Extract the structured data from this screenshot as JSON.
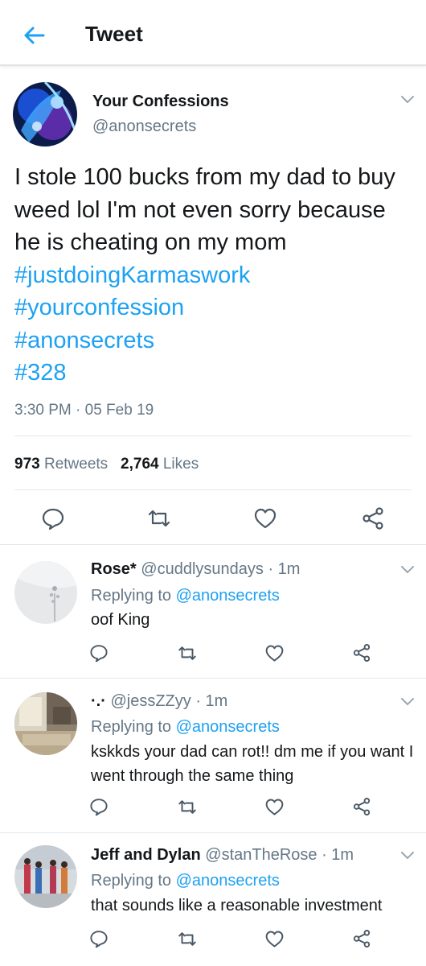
{
  "header": {
    "title": "Tweet"
  },
  "tweet": {
    "author_name": "Your Confessions",
    "author_handle": "@anonsecrets",
    "text": "I stole 100 bucks from my dad to buy weed lol I'm not even sorry because he is cheating on my mom",
    "hashtags": [
      "#justdoingKarmaswork",
      "#yourconfession",
      "#anonsecrets",
      "#328"
    ],
    "timestamp": "3:30 PM · 05 Feb 19",
    "retweet_count": "973",
    "retweet_label": "Retweets",
    "like_count": "2,764",
    "like_label": "Likes"
  },
  "replies": [
    {
      "name": "Rose*",
      "handle": "@cuddlysundays",
      "time": "· 1m",
      "replying_prefix": "Replying to",
      "replying_to": "@anonsecrets",
      "text": "oof King"
    },
    {
      "name": "·.·",
      "handle": "@jessZZyy",
      "time": "· 1m",
      "replying_prefix": "Replying to",
      "replying_to": "@anonsecrets",
      "text": "kskkds your dad can rot!! dm me if you want I went through the same thing"
    },
    {
      "name": "Jeff and Dylan",
      "handle": "@stanTheRose",
      "time": "· 1m",
      "replying_prefix": "Replying to",
      "replying_to": "@anonsecrets",
      "text": "that sounds like a reasonable investment"
    }
  ],
  "colors": {
    "accent": "#1da1f2",
    "text": "#14171a",
    "muted": "#657786",
    "divider": "#e1e8ed"
  }
}
